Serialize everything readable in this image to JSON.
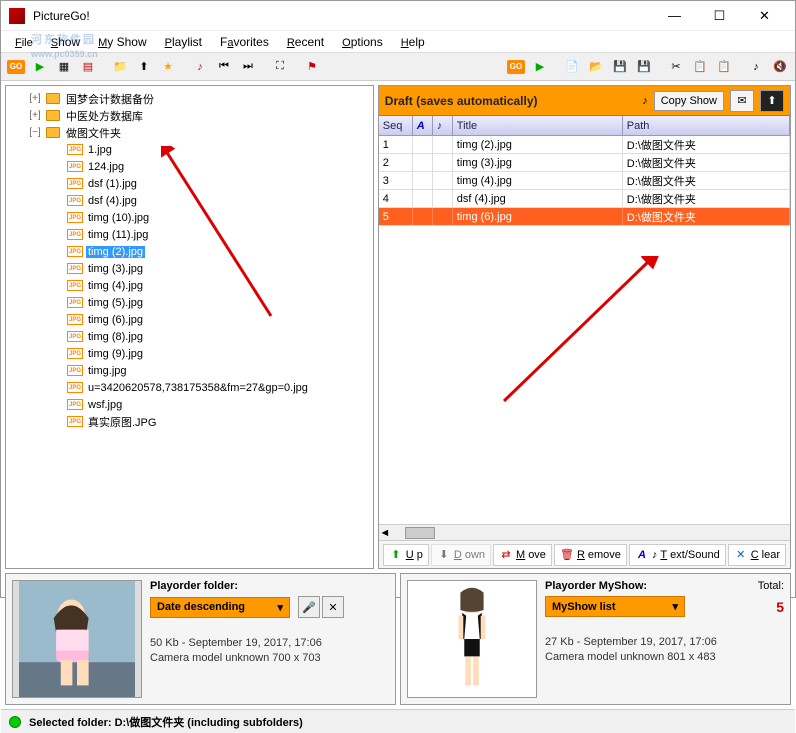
{
  "window": {
    "title": "PictureGo!"
  },
  "menu": {
    "file": "File",
    "show": "Show",
    "myshow": "My Show",
    "playlist": "Playlist",
    "favorites": "Favorites",
    "recent": "Recent",
    "options": "Options",
    "help": "Help"
  },
  "watermark": "河东软件园",
  "watermark_url": "www.pc0359.cn",
  "tree": {
    "folders": [
      {
        "label": "国梦会计数据备份",
        "expand": "+"
      },
      {
        "label": "中医处方数据库",
        "expand": "+"
      },
      {
        "label": "做图文件夹",
        "expand": "−"
      }
    ],
    "files": [
      {
        "label": "1.jpg"
      },
      {
        "label": "124.jpg"
      },
      {
        "label": "dsf (1).jpg"
      },
      {
        "label": "dsf (4).jpg"
      },
      {
        "label": "timg (10).jpg"
      },
      {
        "label": "timg (11).jpg"
      },
      {
        "label": "timg (2).jpg",
        "selected": true
      },
      {
        "label": "timg (3).jpg"
      },
      {
        "label": "timg (4).jpg"
      },
      {
        "label": "timg (5).jpg"
      },
      {
        "label": "timg (6).jpg"
      },
      {
        "label": "timg (8).jpg"
      },
      {
        "label": "timg (9).jpg"
      },
      {
        "label": "timg.jpg"
      },
      {
        "label": "u=3420620578,738175358&fm=27&gp=0.jpg"
      },
      {
        "label": "wsf.jpg"
      },
      {
        "label": "真实原图.JPG"
      }
    ],
    "jpg_badge": "JPG"
  },
  "draft": {
    "title": "Draft (saves automatically)",
    "copy": "Copy Show",
    "headers": {
      "seq": "Seq",
      "a": "A",
      "note": "♪",
      "title": "Title",
      "path": "Path"
    },
    "rows": [
      {
        "seq": "1",
        "title": "timg (2).jpg",
        "path": "D:\\做图文件夹"
      },
      {
        "seq": "2",
        "title": "timg (3).jpg",
        "path": "D:\\做图文件夹"
      },
      {
        "seq": "3",
        "title": "timg (4).jpg",
        "path": "D:\\做图文件夹"
      },
      {
        "seq": "4",
        "title": "dsf (4).jpg",
        "path": "D:\\做图文件夹"
      },
      {
        "seq": "5",
        "title": "timg (6).jpg",
        "path": "D:\\做图文件夹",
        "selected": true
      }
    ]
  },
  "actions": {
    "up": "Up",
    "down": "Down",
    "move": "Move",
    "remove": "Remove",
    "textsound": "Text/Sound",
    "clear": "Clear"
  },
  "bottomleft": {
    "label": "Playorder folder:",
    "dropdown": "Date descending",
    "meta1": "50 Kb -    September 19, 2017, 17:06",
    "meta2": "Camera model unknown   700 x 703"
  },
  "bottomright": {
    "label": "Playorder MyShow:",
    "total_label": "Total:",
    "total": "5",
    "dropdown": "MyShow list",
    "meta1": "27 Kb -    September 19, 2017, 17:06",
    "meta2": "Camera model unknown   801 x 483"
  },
  "status": {
    "text": "Selected folder: D:\\做图文件夹 (including subfolders)"
  }
}
